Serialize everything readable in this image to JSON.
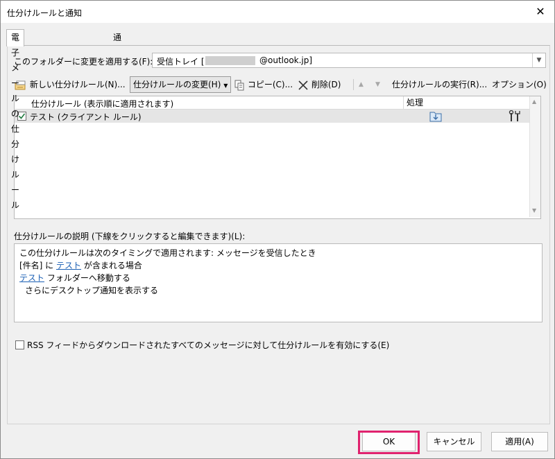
{
  "window": {
    "title": "仕分けルールと通知",
    "close_glyph": "✕"
  },
  "tabs": [
    {
      "label": "電子メールの仕分けルール",
      "active": true
    },
    {
      "label": "通知の管理",
      "active": false
    }
  ],
  "folder": {
    "label": "このフォルダーに変更を適用する(F):",
    "value_prefix": "受信トレイ [",
    "value_suffix": "@outlook.jp]"
  },
  "toolbar": {
    "new_rule": "新しい仕分けルール(N)...",
    "change_rule": "仕分けルールの変更(H)",
    "copy": "コピー(C)...",
    "delete": "削除(D)",
    "run_rules": "仕分けルールの実行(R)...",
    "options": "オプション(O)"
  },
  "rules_table": {
    "headers": [
      "仕分けルール (表示順に適用されます)",
      "処理"
    ],
    "rows": [
      {
        "name": "テスト (クライアント ルール)",
        "checked": true
      }
    ]
  },
  "description": {
    "label": "仕分けルールの説明 (下線をクリックすると編集できます)(L):",
    "line1": "この仕分けルールは次のタイミングで適用されます: メッセージを受信したとき",
    "line2_a": "[件名] に ",
    "line2_link": "テスト",
    "line2_b": " が含まれる場合",
    "line3_link": "テスト",
    "line3_b": " フォルダーへ移動する",
    "line4": "さらにデスクトップ通知を表示する"
  },
  "rss": {
    "label": "RSS フィードからダウンロードされたすべてのメッセージに対して仕分けルールを有効にする(E)",
    "checked": false
  },
  "buttons": {
    "ok": "OK",
    "cancel": "キャンセル",
    "apply": "適用(A)"
  },
  "colors": {
    "highlight": "#e0226e",
    "link": "#1a5fb4",
    "selected_row": "#e5e5e5"
  }
}
